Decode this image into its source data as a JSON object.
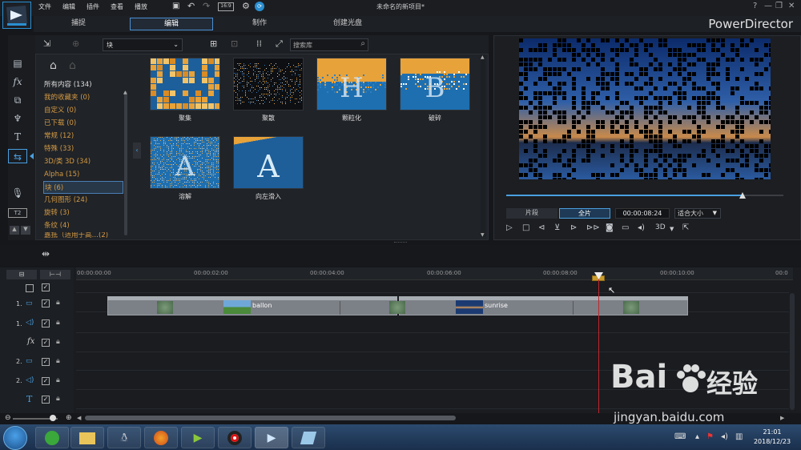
{
  "titlebar": {
    "menu": [
      "文件",
      "编辑",
      "插件",
      "查看",
      "播放"
    ],
    "title": "未命名的新项目*",
    "help": "?"
  },
  "modes": {
    "capture": "捕捉",
    "edit": "编辑",
    "produce": "制作",
    "disc": "创建光盘",
    "app": "PowerDirector"
  },
  "library": {
    "category": "块",
    "search_placeholder": "搜索库",
    "categories": [
      "所有内容 (134)",
      "我的收藏夹 (0)",
      "自定义 (0)",
      "已下载 (0)",
      "常规 (12)",
      "特殊 (33)",
      "3D/类 3D (34)",
      "Alpha (15)",
      "块 (6)",
      "几何图形 (24)",
      "旋转 (3)",
      "条纹 (4)",
      "嘉抵（适用于高…(2)"
    ],
    "thumbs": [
      "聚集",
      "聚散",
      "颗粒化",
      "破碎",
      "溶解",
      "向左滑入"
    ]
  },
  "preview": {
    "clip_label": "片段",
    "movie_label": "全片",
    "timecode": "00:00:08:24",
    "fit": "适合大小",
    "mode3d": "3D"
  },
  "timeline": {
    "ticks": [
      "00:00:00:00",
      "00:00:02:00",
      "00:00:04:00",
      "00:00:06:00",
      "00:00:08:00",
      "00:00:10:00",
      "00:0"
    ],
    "tracks": [
      "1.",
      "1.",
      "",
      "2.",
      "2.",
      ""
    ],
    "clips": [
      "ballon",
      "sunrise"
    ]
  },
  "taskbar": {
    "time": "21:01",
    "date": "2018/12/23"
  },
  "watermark": {
    "brand": "Bai",
    "brand2": "经验",
    "url": "jingyan.baidu.com"
  },
  "colors": {
    "accent": "#4a9fe0",
    "category": "#d49a45",
    "playhead": "#c0262b"
  }
}
